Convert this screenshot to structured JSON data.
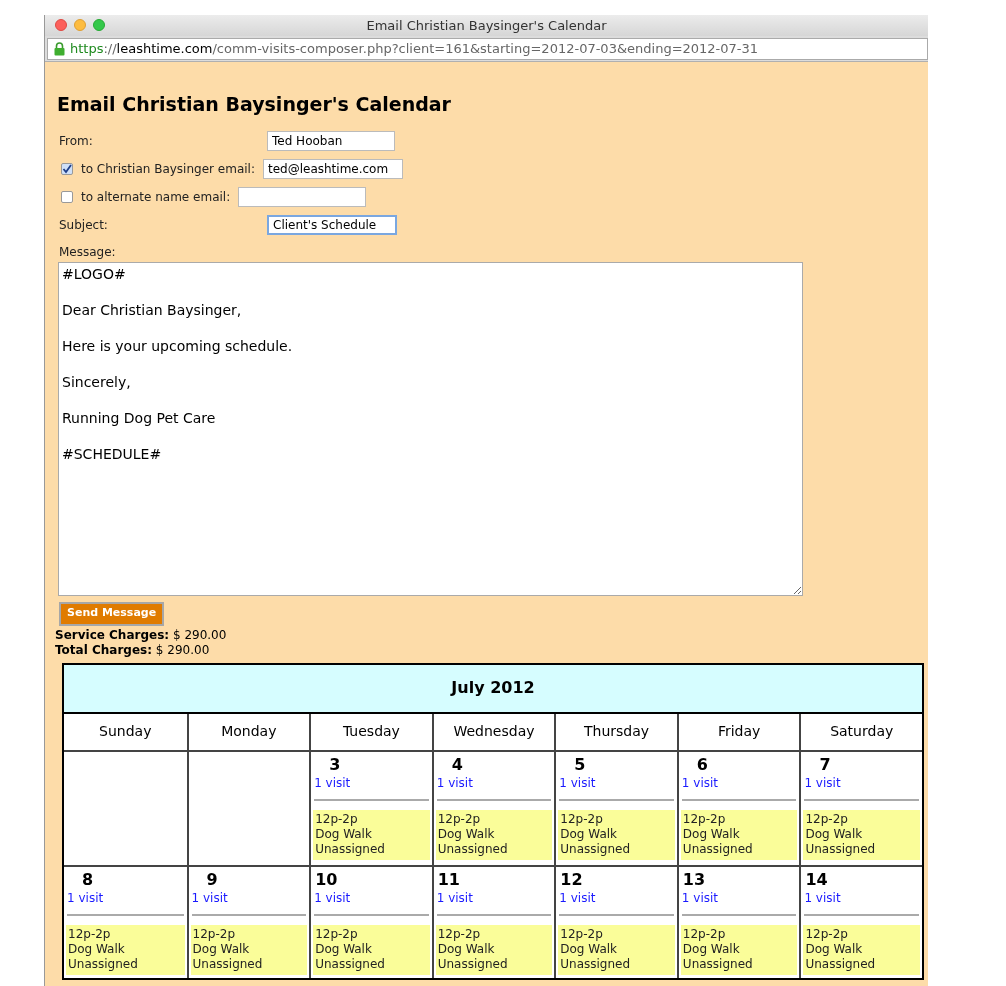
{
  "window": {
    "title": "Email Christian Baysinger's Calendar"
  },
  "address_bar": {
    "scheme": "https",
    "separator": "://",
    "host": "leashtime.com",
    "path": "/comm-visits-composer.php?client=161&starting=2012-07-03&ending=2012-07-31"
  },
  "heading": "Email Christian Baysinger's Calendar",
  "form": {
    "from": {
      "label": "From:",
      "value": "Ted Hooban"
    },
    "recipients": [
      {
        "label": "to Christian Baysinger email:",
        "checked": true,
        "value": "ted@leashtime.com"
      },
      {
        "label": "to alternate name email:",
        "checked": false
      }
    ],
    "subject": {
      "label": "Subject:",
      "value": "Client's Schedule",
      "focused": true
    },
    "message": {
      "label": "Message:",
      "lines": [
        "#LOGO#",
        "Dear Christian Baysinger,",
        "Here is your upcoming schedule.",
        "Sincerely,",
        "Running Dog Pet Care",
        "#SCHEDULE#"
      ]
    },
    "send_button": "Send Message"
  },
  "charges": [
    {
      "label": "Service Charges:",
      "amount": "$ 290.00"
    },
    {
      "label": "Total Charges:",
      "amount": "$ 290.00"
    }
  ],
  "calendar": {
    "title": "July 2012",
    "weekdays": [
      "Sunday",
      "Monday",
      "Tuesday",
      "Wednesday",
      "Thursday",
      "Friday",
      "Saturday"
    ],
    "weeks": [
      [
        {
          "kind": "blank"
        },
        {
          "kind": "blank"
        },
        {
          "kind": "day",
          "day": "3",
          "visits": "1 visit",
          "appointments": [
            {
              "time": "12p-2p",
              "service": "Dog Walk",
              "sitter": "Unassigned"
            }
          ]
        },
        {
          "kind": "day",
          "day": "4",
          "visits": "1 visit",
          "appointments": [
            {
              "time": "12p-2p",
              "service": "Dog Walk",
              "sitter": "Unassigned"
            }
          ]
        },
        {
          "kind": "day",
          "day": "5",
          "visits": "1 visit",
          "appointments": [
            {
              "time": "12p-2p",
              "service": "Dog Walk",
              "sitter": "Unassigned"
            }
          ]
        },
        {
          "kind": "day",
          "day": "6",
          "visits": "1 visit",
          "appointments": [
            {
              "time": "12p-2p",
              "service": "Dog Walk",
              "sitter": "Unassigned"
            }
          ]
        },
        {
          "kind": "day",
          "day": "7",
          "visits": "1 visit",
          "appointments": [
            {
              "time": "12p-2p",
              "service": "Dog Walk",
              "sitter": "Unassigned"
            }
          ]
        }
      ],
      [
        {
          "kind": "day",
          "day": "8",
          "visits": "1 visit",
          "appointments": [
            {
              "time": "12p-2p",
              "service": "Dog Walk",
              "sitter": "Unassigned"
            }
          ]
        },
        {
          "kind": "day",
          "day": "9",
          "visits": "1 visit",
          "appointments": [
            {
              "time": "12p-2p",
              "service": "Dog Walk",
              "sitter": "Unassigned"
            }
          ]
        },
        {
          "kind": "day",
          "day": "10",
          "visits": "1 visit",
          "appointments": [
            {
              "time": "12p-2p",
              "service": "Dog Walk",
              "sitter": "Unassigned"
            }
          ]
        },
        {
          "kind": "day",
          "day": "11",
          "visits": "1 visit",
          "appointments": [
            {
              "time": "12p-2p",
              "service": "Dog Walk",
              "sitter": "Unassigned"
            }
          ]
        },
        {
          "kind": "day",
          "day": "12",
          "visits": "1 visit",
          "appointments": [
            {
              "time": "12p-2p",
              "service": "Dog Walk",
              "sitter": "Unassigned"
            }
          ]
        },
        {
          "kind": "day",
          "day": "13",
          "visits": "1 visit",
          "appointments": [
            {
              "time": "12p-2p",
              "service": "Dog Walk",
              "sitter": "Unassigned"
            }
          ]
        },
        {
          "kind": "day",
          "day": "14",
          "visits": "1 visit",
          "appointments": [
            {
              "time": "12p-2p",
              "service": "Dog Walk",
              "sitter": "Unassigned"
            }
          ]
        }
      ]
    ]
  }
}
